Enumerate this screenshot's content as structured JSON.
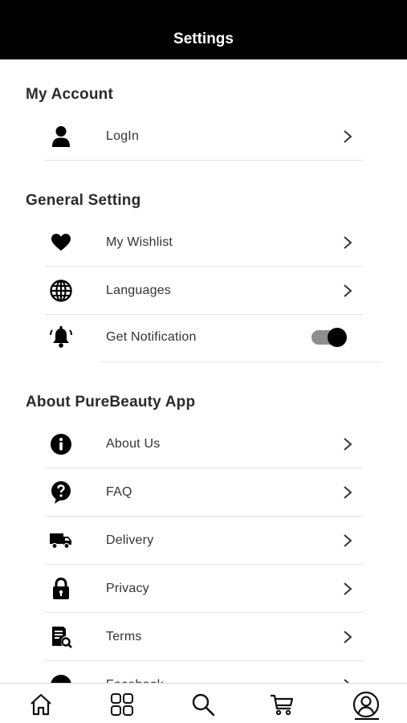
{
  "header": {
    "title": "Settings"
  },
  "sections": {
    "account": {
      "title": "My Account",
      "items": [
        {
          "label": "LogIn",
          "icon": "user-icon"
        }
      ]
    },
    "general": {
      "title": "General Setting",
      "items": [
        {
          "label": "My Wishlist",
          "icon": "heart-icon"
        },
        {
          "label": "Languages",
          "icon": "globe-icon"
        },
        {
          "label": "Get Notification",
          "icon": "bell-icon",
          "toggle_on": true
        }
      ]
    },
    "about": {
      "title": "About PureBeauty App",
      "items": [
        {
          "label": "About Us",
          "icon": "info-icon"
        },
        {
          "label": "FAQ",
          "icon": "question-icon"
        },
        {
          "label": "Delivery",
          "icon": "truck-icon"
        },
        {
          "label": "Privacy",
          "icon": "lock-icon"
        },
        {
          "label": "Terms",
          "icon": "document-search-icon"
        },
        {
          "label": "Facebook",
          "icon": "facebook-icon"
        }
      ]
    }
  },
  "bottom_nav": {
    "items": [
      {
        "icon": "home-icon"
      },
      {
        "icon": "categories-icon"
      },
      {
        "icon": "search-icon"
      },
      {
        "icon": "cart-icon"
      },
      {
        "icon": "profile-icon",
        "active": true
      }
    ]
  },
  "colors": {
    "header_bg": "#000000",
    "toggle_track": "#8e8e8e",
    "toggle_knob": "#000000",
    "divider": "#e2e2e2"
  }
}
